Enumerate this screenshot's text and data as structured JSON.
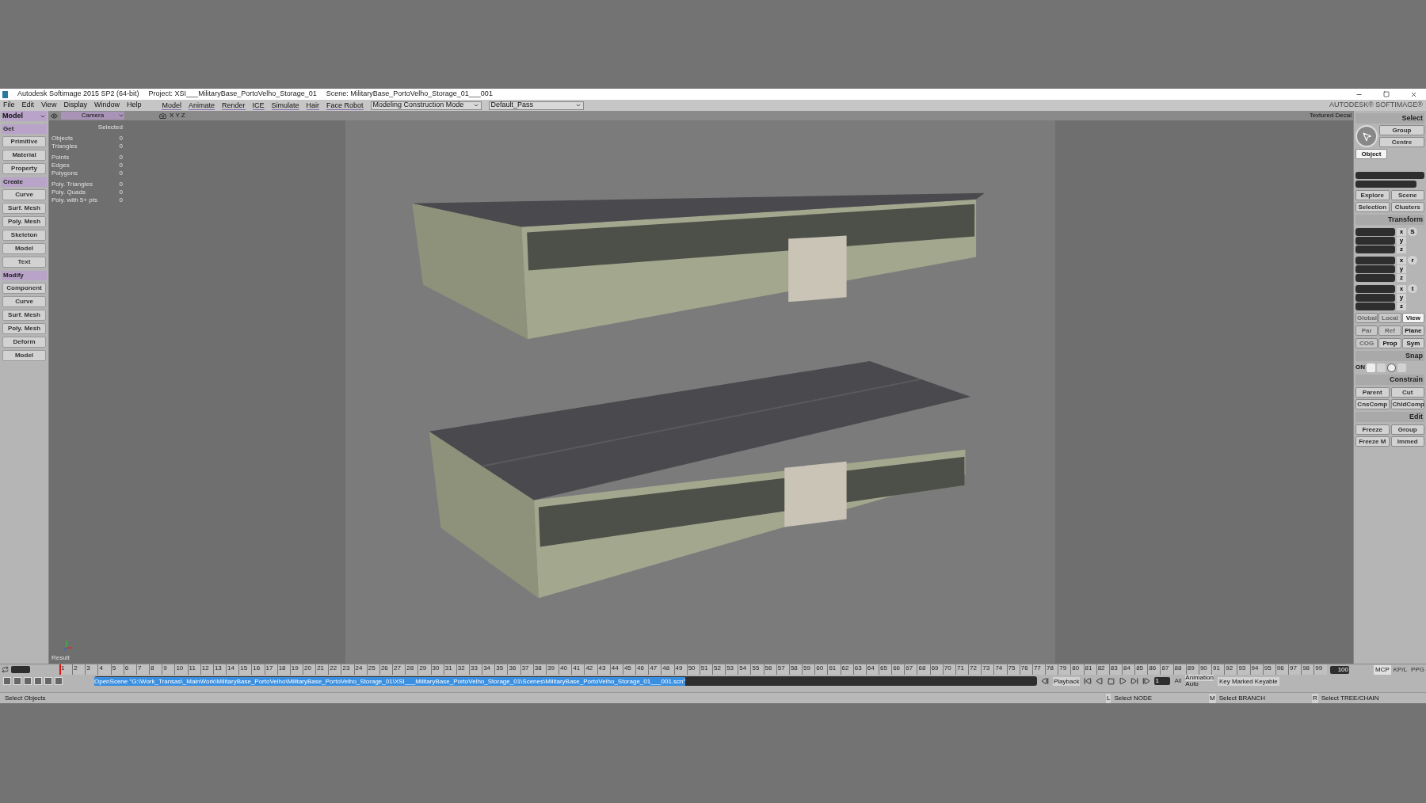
{
  "title_bar": {
    "app": "Autodesk Softimage 2015 SP2 (64-bit)",
    "project": "Project: XSI___MilitaryBase_PortoVelho_Storage_01",
    "scene": "Scene: MilitaryBase_PortoVelho_Storage_01___001"
  },
  "menu": {
    "items": [
      "File",
      "Edit",
      "View",
      "Display",
      "Window",
      "Help"
    ],
    "modules": [
      "Model",
      "Animate",
      "Render",
      "ICE",
      "Simulate",
      "Hair",
      "Face Robot"
    ],
    "mode_dropdown": "Modeling Construction Mode",
    "pass_dropdown": "Default_Pass",
    "logo": "AUTODESK® SOFTIMAGE®"
  },
  "left_panel": {
    "toolbar": "Model",
    "sections": [
      {
        "title": "Get",
        "buttons": [
          "Primitive",
          "Material",
          "Property"
        ]
      },
      {
        "title": "Create",
        "buttons": [
          "Curve",
          "Surf. Mesh",
          "Poly. Mesh",
          "Skeleton",
          "Model",
          "Text"
        ]
      },
      {
        "title": "Modify",
        "buttons": [
          "Component",
          "Curve",
          "Surf. Mesh",
          "Poly. Mesh",
          "Deform",
          "Model"
        ]
      }
    ]
  },
  "viewport": {
    "camera": "Camera",
    "axes": "X Y Z",
    "display_mode": "Textured Decal",
    "stats_header": "Selected",
    "stat_groups": [
      [
        {
          "label": "Objects",
          "value": "0"
        },
        {
          "label": "Triangles",
          "value": "0"
        }
      ],
      [
        {
          "label": "Points",
          "value": "0"
        },
        {
          "label": "Edges",
          "value": "0"
        },
        {
          "label": "Polygons",
          "value": "0"
        }
      ],
      [
        {
          "label": "Poly. Triangles",
          "value": "0"
        },
        {
          "label": "Poly. Quads",
          "value": "0"
        },
        {
          "label": "Poly. with 5+ pts",
          "value": "0"
        }
      ]
    ],
    "result": "Result",
    "scene_view": {
      "kind": "picture"
    }
  },
  "right_panel": {
    "select_title": "Select",
    "select_buttons": [
      {
        "label": "Group",
        "selected": false
      },
      {
        "label": "Centre",
        "selected": false
      },
      {
        "label": "Object",
        "selected": true
      }
    ],
    "explore_buttons": [
      "Explore",
      "Scene",
      "Selection",
      "Clusters"
    ],
    "transform_title": "Transform",
    "transform_groups": [
      {
        "axes": [
          "x",
          "y",
          "z"
        ],
        "key": "S"
      },
      {
        "axes": [
          "x",
          "y",
          "z"
        ],
        "key": "r"
      },
      {
        "axes": [
          "x",
          "y",
          "z"
        ],
        "key": "t"
      }
    ],
    "mode_rows": [
      [
        {
          "label": "Global",
          "disabled": true,
          "selected": false
        },
        {
          "label": "Local",
          "disabled": true,
          "selected": false
        },
        {
          "label": "View",
          "disabled": false,
          "selected": true
        }
      ],
      [
        {
          "label": "Par",
          "disabled": true,
          "selected": false
        },
        {
          "label": "Ref",
          "disabled": true,
          "selected": false
        },
        {
          "label": "Plane",
          "disabled": false,
          "selected": false
        }
      ],
      [
        {
          "label": "COG",
          "disabled": true,
          "selected": false
        },
        {
          "label": "Prop",
          "disabled": false,
          "selected": false
        },
        {
          "label": "Sym",
          "disabled": false,
          "selected": false
        }
      ]
    ],
    "snap_title": "Snap",
    "snap_on": "ON",
    "constrain_title": "Constrain",
    "constrain_buttons": [
      "Parent",
      "Cut",
      "CnsComp",
      "ChldComp"
    ],
    "edit_title": "Edit",
    "edit_buttons": [
      "Freeze",
      "Group",
      "Freeze M",
      "Immed"
    ]
  },
  "timeline": {
    "frames": [
      "1",
      "2",
      "3",
      "4",
      "5",
      "6",
      "7",
      "8",
      "9",
      "10",
      "11",
      "12",
      "13",
      "14",
      "15",
      "16",
      "17",
      "18",
      "19",
      "20",
      "21",
      "22",
      "23",
      "24",
      "25",
      "26",
      "27",
      "28",
      "29",
      "30",
      "31",
      "32",
      "33",
      "34",
      "35",
      "36",
      "37",
      "38",
      "39",
      "40",
      "41",
      "42",
      "43",
      "44",
      "45",
      "46",
      "47",
      "48",
      "49",
      "50",
      "51",
      "52",
      "53",
      "54",
      "55",
      "56",
      "57",
      "58",
      "59",
      "60",
      "61",
      "62",
      "63",
      "64",
      "65",
      "66",
      "67",
      "68",
      "69",
      "70",
      "71",
      "72",
      "73",
      "74",
      "75",
      "76",
      "77",
      "78",
      "79",
      "80",
      "81",
      "82",
      "83",
      "84",
      "85",
      "86",
      "87",
      "88",
      "89",
      "90",
      "91",
      "92",
      "93",
      "94",
      "95",
      "96",
      "97",
      "98",
      "99"
    ],
    "end_frame": "100",
    "tabs": [
      {
        "label": "MCP",
        "selected": true
      },
      {
        "label": "KP/L",
        "selected": false
      },
      {
        "label": "PPG",
        "selected": false
      }
    ]
  },
  "command_line": "OpenScene \"G:\\Work_Transas\\_MainWork\\MilitaryBase_PortoVelho\\MilitaryBase_PortoVelho_Storage_01\\XSI___MilitaryBase_PortoVelho_Storage_01\\Scenes\\MilitaryBase_PortoVelho_Storage_01___001.scn\"",
  "playback": {
    "label": "Playback",
    "frame": "1",
    "all": "All",
    "animation": "Animation",
    "auto": "Auto",
    "keying": "Key Marked Keyable"
  },
  "status_bar": {
    "message": "Select Objects",
    "mouse": [
      {
        "key": "L",
        "action": "Select NODE"
      },
      {
        "key": "M",
        "action": "Select BRANCH"
      },
      {
        "key": "R",
        "action": "Select TREE/CHAIN"
      }
    ]
  }
}
